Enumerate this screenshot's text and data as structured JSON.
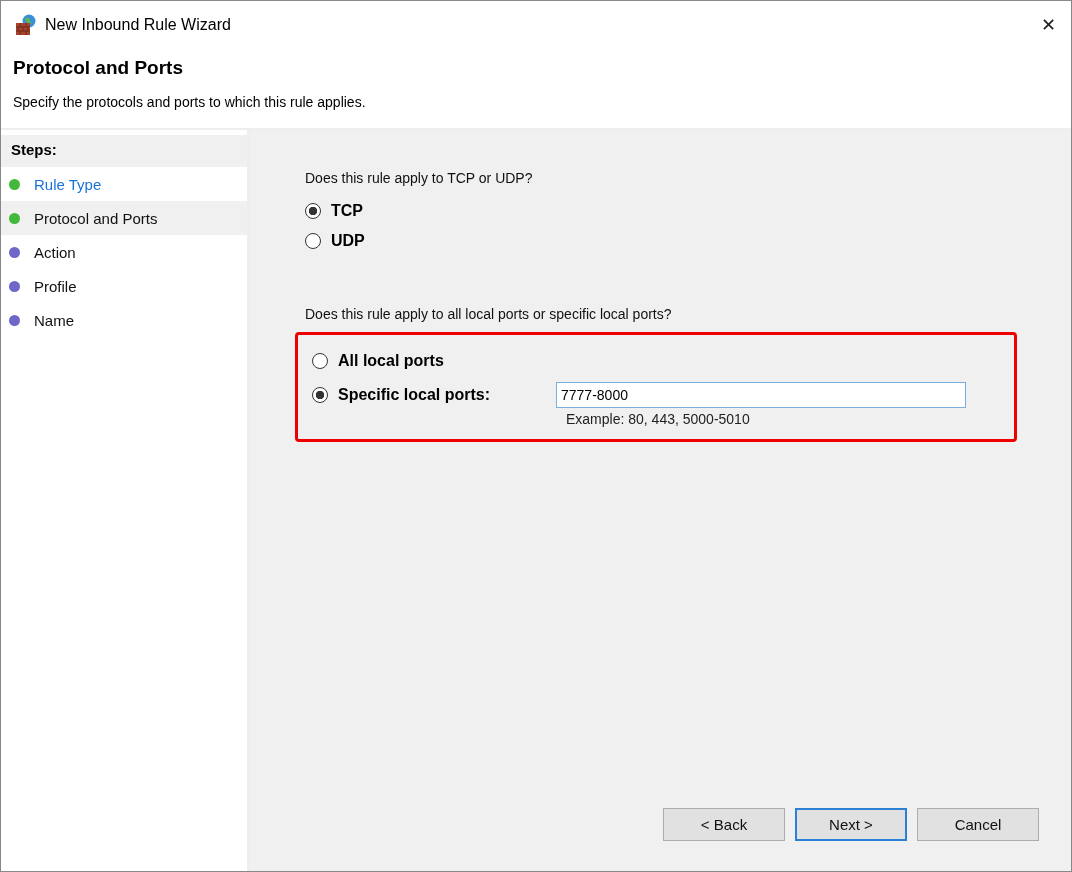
{
  "window": {
    "title": "New Inbound Rule Wizard",
    "close": "✕"
  },
  "header": {
    "title": "Protocol and Ports",
    "subtitle": "Specify the protocols and ports to which this rule applies."
  },
  "steps": {
    "heading": "Steps:",
    "items": [
      {
        "label": "Rule Type",
        "completed": true,
        "selected": false
      },
      {
        "label": "Protocol and Ports",
        "completed": true,
        "selected": true
      },
      {
        "label": "Action",
        "completed": false,
        "selected": false
      },
      {
        "label": "Profile",
        "completed": false,
        "selected": false
      },
      {
        "label": "Name",
        "completed": false,
        "selected": false
      }
    ]
  },
  "protocol": {
    "question": "Does this rule apply to TCP or UDP?",
    "options": [
      {
        "label": "TCP",
        "selected": true
      },
      {
        "label": "UDP",
        "selected": false
      }
    ]
  },
  "ports": {
    "question": "Does this rule apply to all local ports or specific local ports?",
    "highlighted": true,
    "options": [
      {
        "label": "All local ports",
        "selected": false
      },
      {
        "label": "Specific local ports:",
        "selected": true,
        "value": "7777-8000",
        "hint": "Example: 80, 443, 5000-5010"
      }
    ]
  },
  "buttons": [
    {
      "label": "< Back",
      "default": false
    },
    {
      "label": "Next >",
      "default": true
    },
    {
      "label": "Cancel",
      "default": false
    }
  ]
}
